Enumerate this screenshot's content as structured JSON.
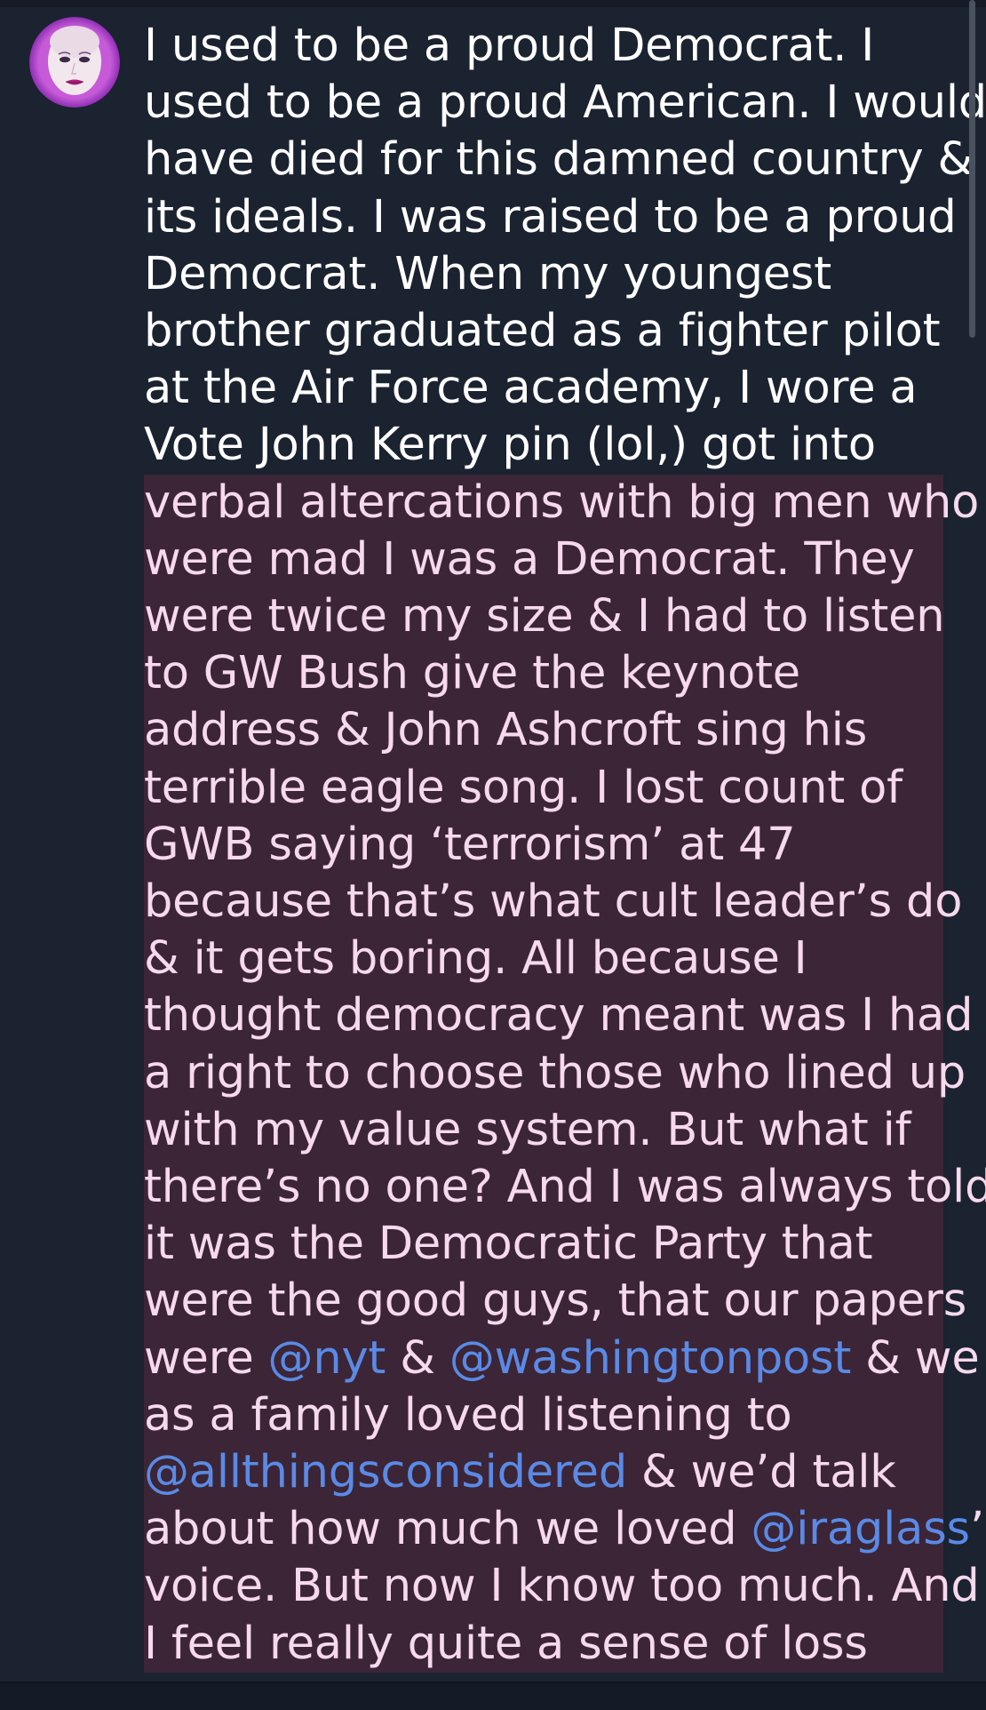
{
  "post": {
    "avatar_icon": "avatar-illustrated-face-icon",
    "caption_plain": [
      "I used to be a proud Democrat. I",
      "used to be a proud American. I would",
      "have died for this damned country &",
      "its ideals. I was raised to be a proud",
      "Democrat. When my youngest",
      "brother graduated as a fighter pilot",
      "at the Air Force academy, I wore a",
      "Vote John Kerry pin (lol,) got into"
    ],
    "caption_highlighted": [
      "verbal altercations with big men who",
      "were mad I was a Democrat. They",
      "were twice my size & I had to listen",
      "to GW Bush give the keynote",
      "address & John Ashcroft sing his",
      "terrible eagle song. I lost count of",
      "GWB saying ‘terrorism’ at 47",
      "because that’s what cult leader’s do",
      "& it gets boring. All because I",
      "thought democracy meant was I had",
      "a right to choose those who lined up",
      "with my value system. But what if",
      "there’s no one? And I was always told",
      "it was the Democratic Party that",
      "were the good guys, that our papers"
    ],
    "line_23": {
      "before": "were ",
      "mention_1": "@nyt",
      "middle": " & ",
      "mention_2": "@washingtonpost",
      "after": " & we"
    },
    "line_24": "as a family loved listening to",
    "line_25": {
      "mention": "@allthingsconsidered",
      "after": " & we’d talk"
    },
    "line_26": {
      "before": "about how much we loved ",
      "mention": "@iraglass",
      "after": "’"
    },
    "line_27": "voice. But now I know too much. And",
    "line_28": "I feel really quite a sense of loss"
  },
  "colors": {
    "background": "#1b2230",
    "text": "#ffffff",
    "highlight_bg": "#3c2536",
    "highlight_text": "#f6d9ec",
    "mention": "#5a8ae6"
  }
}
